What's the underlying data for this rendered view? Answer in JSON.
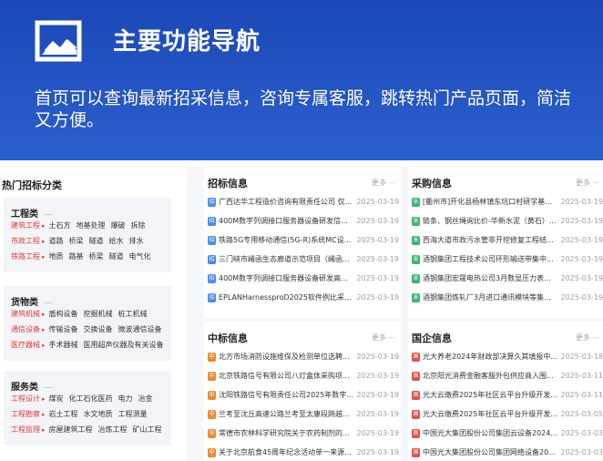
{
  "banner": {
    "title": "主要功能导航",
    "description": "首页可以查询最新招采信息，咨询专属客服，跳转热门产品页面，简洁又方便。"
  },
  "left": {
    "title": "热门招标分类",
    "categories": [
      {
        "name": "工程类",
        "more": "—",
        "rows": [
          {
            "key": "建筑工程",
            "items": [
              "土石方",
              "地基处理",
              "爆破",
              "拆除"
            ]
          },
          {
            "key": "市政工程",
            "items": [
              "道路",
              "桥梁",
              "隧道",
              "给水",
              "排水"
            ]
          },
          {
            "key": "铁路工程",
            "items": [
              "地质",
              "路基",
              "桥梁",
              "隧道",
              "电气化"
            ]
          }
        ]
      },
      {
        "name": "货物类",
        "more": "—",
        "rows": [
          {
            "key": "建筑机械",
            "items": [
              "盾构设备",
              "挖掘机械",
              "桩工机械"
            ]
          },
          {
            "key": "通信设备",
            "items": [
              "传输设备",
              "交换设备",
              "微波通信设备"
            ]
          },
          {
            "key": "医疗器械",
            "items": [
              "手术器械",
              "医用超声仪器及有关设备"
            ]
          }
        ]
      },
      {
        "name": "服务类",
        "more": "—",
        "rows": [
          {
            "key": "工程设计",
            "items": [
              "煤炭",
              "化工石化医药",
              "电力",
              "冶金"
            ]
          },
          {
            "key": "工程勘察",
            "items": [
              "岩土工程",
              "水文地质",
              "工程测量"
            ]
          },
          {
            "key": "工程监理",
            "items": [
              "房屋建筑工程",
              "冶炼工程",
              "矿山工程"
            ]
          }
        ]
      }
    ]
  },
  "panels": [
    {
      "title": "招标信息",
      "more": "更多",
      "icon": "招",
      "color": "#4a8cf0",
      "rows": [
        {
          "title": "广西达华工程造价咨询有限责任公司 仅...",
          "date": "2025-03-19"
        },
        {
          "title": "400M数字列调接口服务器设备研发信...",
          "date": "2025-03-19"
        },
        {
          "title": "铁路5G专用移动通信(5G-R)系统MC设...",
          "date": "2025-03-19"
        },
        {
          "title": "三门峡市崤函生态廊道示范项目（崤函...",
          "date": "2025-03-19"
        },
        {
          "title": "400M数字列调接口服务器设备研发高...",
          "date": "2025-03-19"
        },
        {
          "title": "EPLANHarnessproD2025软件例比采...",
          "date": "2025-03-19"
        }
      ]
    },
    {
      "title": "采购信息",
      "more": "更多",
      "icon": "采",
      "color": "#3cb46e",
      "rows": [
        {
          "title": "[衢州市]开化县杨林镇东坑口村研学基...",
          "date": "2025-03-19"
        },
        {
          "title": "链条、钢丝绳询比价-华新水泥（黄石）...",
          "date": "2025-03-19"
        },
        {
          "title": "西海大道市政污水管非开挖修复工程结...",
          "date": "2025-03-19"
        },
        {
          "title": "酒钢集团工程技术公司环形输送带集中...",
          "date": "2025-03-19"
        },
        {
          "title": "酒钢集团宏晟电热公司3月数显压力表...",
          "date": "2025-03-19"
        },
        {
          "title": "酒钢集团炼轧厂3月进口通讯模块等集...",
          "date": "2025-03-19"
        }
      ]
    },
    {
      "title": "中标信息",
      "more": "更多",
      "icon": "中",
      "color": "#f08a2c",
      "rows": [
        {
          "title": "北方市场消防设施维保及检测单位选聘...",
          "date": "2025-03-19"
        },
        {
          "title": "北京铁路信号有限公司八灯盒体采购项...",
          "date": "2025-03-19"
        },
        {
          "title": "沈阳铁路信号有限责任公司2025年数字...",
          "date": "2025-03-19"
        },
        {
          "title": "兰考至沈丘高速公路兰考至太康段跨越...",
          "date": "2025-03-19"
        },
        {
          "title": "常德市农林科学研究院关于农药制剂的...",
          "date": "2025-03-19"
        },
        {
          "title": "关于北京航食45周年纪念活动单一来源...",
          "date": "2025-03-19"
        }
      ]
    },
    {
      "title": "国企信息",
      "more": "更多",
      "icon": "国",
      "color": "#e2514e",
      "rows": [
        {
          "title": "光大养老2024年财政部决算久其填报中...",
          "date": "2025-03-18"
        },
        {
          "title": "北京阳光消费金融客服外包供应商入围...",
          "date": "2025-03-11"
        },
        {
          "title": "光大云缴费2025年社区云平台升级开发...",
          "date": "2025-03-11"
        },
        {
          "title": "光大云缴费2025年社区云平台升级开发...",
          "date": "2025-03-05"
        },
        {
          "title": "中国光大集团股份公司集团云设备2024...",
          "date": "2025-03-03"
        },
        {
          "title": "中国光大集团股份公司集团网络设备20...",
          "date": "2025-03-03"
        }
      ]
    }
  ]
}
